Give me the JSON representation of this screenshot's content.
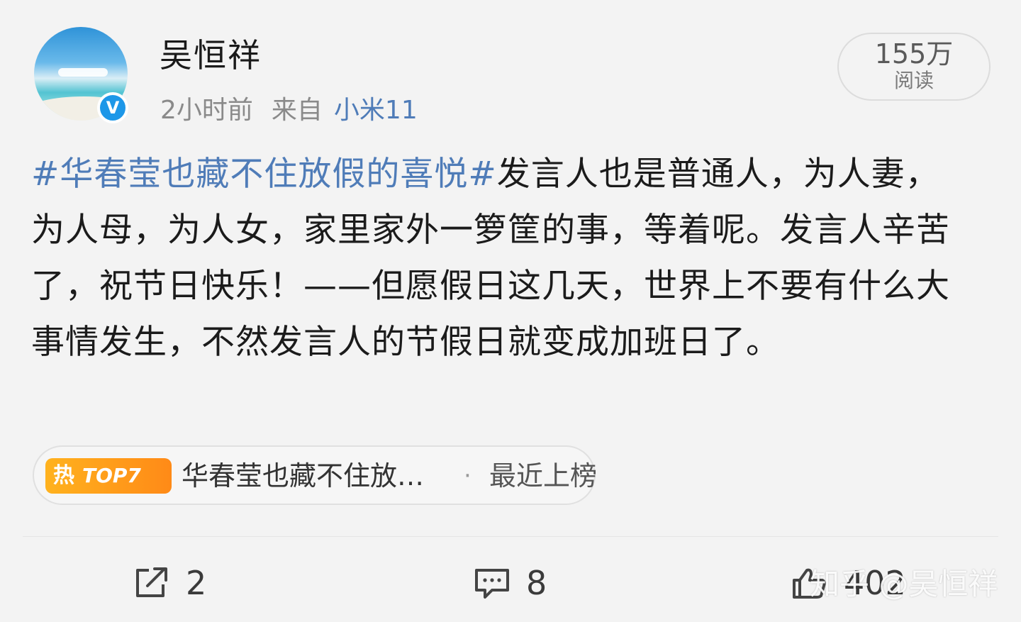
{
  "author": {
    "name": "吴恒祥",
    "verified_icon": "V"
  },
  "meta": {
    "time": "2小时前",
    "source_label": "来自",
    "source_device": "小米11"
  },
  "reads": {
    "count": "155万",
    "label": "阅读"
  },
  "post": {
    "hashtag": "#华春莹也藏不住放假的喜悦#",
    "text": "发言人也是普通人，为人妻，为人母，为人女，家里家外一箩筐的事，等着呢。发言人辛苦了，祝节日快乐！——但愿假日这几天，世界上不要有什么大事情发生，不然发言人的节假日就变成加班日了。"
  },
  "trending": {
    "hot_label": "热",
    "rank_label": "TOP7",
    "topic": "华春莹也藏不住放…",
    "separator": "·",
    "status": "最近上榜"
  },
  "actions": {
    "repost_count": "2",
    "comment_count": "8",
    "like_count": "402"
  },
  "watermark": "知乎 @吴恒祥",
  "colors": {
    "link_blue": "#4f7cb8",
    "verified_blue": "#1d97e8",
    "hot_orange": "#ff8a17",
    "background": "#f3f3f3"
  }
}
